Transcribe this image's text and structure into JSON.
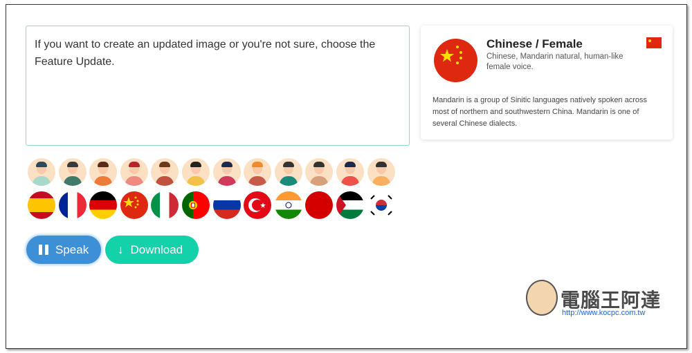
{
  "text_input": {
    "value": "If you want to create an updated image or you're not sure, choose the Feature Update."
  },
  "voice_card": {
    "title": "Chinese / Female",
    "subtitle": "Chinese, Mandarin natural, human-like female voice.",
    "description": "Mandarin is a group of Sinitic languages natively spoken across most of northern and southwestern China. Mandarin is one of several Chinese dialects."
  },
  "avatars": [
    {
      "hair": "#2c4a5a",
      "shirt": "#a8d8c8"
    },
    {
      "hair": "#3a3a3a",
      "shirt": "#3f7a6a"
    },
    {
      "hair": "#5a2a1a",
      "shirt": "#f07a3a"
    },
    {
      "hair": "#b8242a",
      "shirt": "#f08a80"
    },
    {
      "hair": "#6a3a1a",
      "shirt": "#c05040"
    },
    {
      "hair": "#222",
      "shirt": "#f3c04a"
    },
    {
      "hair": "#1a2a4a",
      "shirt": "#d03a5a"
    },
    {
      "hair": "#f08a2a",
      "shirt": "#c85a4a"
    },
    {
      "hair": "#333",
      "shirt": "#1a8a7a"
    },
    {
      "hair": "#333",
      "shirt": "#d8a07a"
    },
    {
      "hair": "#1a2a4a",
      "shirt": "#f0504a"
    },
    {
      "hair": "#333",
      "shirt": "#f8b060"
    }
  ],
  "flags": [
    "spain",
    "france",
    "germany",
    "china",
    "italy",
    "portugal",
    "russia",
    "turkey",
    "india",
    "japan",
    "palestine",
    "south-korea"
  ],
  "buttons": {
    "speak": "Speak",
    "download": "Download"
  },
  "watermark": {
    "text": "電腦王阿達",
    "url": "http://www.kocpc.com.tw"
  },
  "colors": {
    "speak": "#3d8fd6",
    "download": "#13d1a8",
    "china_red": "#de2910"
  }
}
